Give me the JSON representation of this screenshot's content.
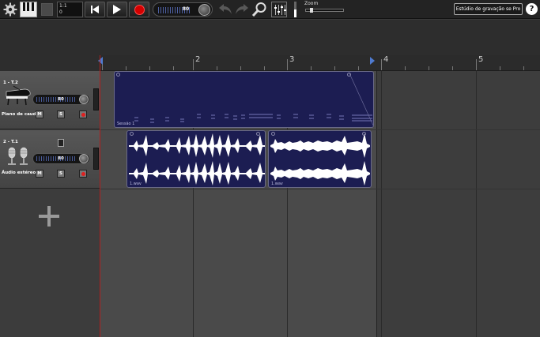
{
  "toolbar": {
    "counter_line1": "1:1",
    "counter_line2": "0",
    "master_volume": "80",
    "zoom_label": "Zoom",
    "pro_button": "Estúdio de gravação se Pro",
    "help": "?"
  },
  "timeline": {
    "bars": [
      "2",
      "3",
      "4",
      "5"
    ]
  },
  "tracks": [
    {
      "title": "1 - T.2",
      "name": "Piano de cauda",
      "instrument_icon": "grand-piano-icon",
      "volume": "80",
      "mute": "M",
      "solo": "S"
    },
    {
      "title": "2 - T.1",
      "name": "Áudio estéreo",
      "instrument_icon": "microphone-icon",
      "volume": "80",
      "mute": "M",
      "solo": "S"
    }
  ],
  "clips": {
    "midi_clip_label": "Sessão 1",
    "audio_clip_1_label": "1.wav",
    "audio_clip_2_label": "1.wav"
  },
  "colors": {
    "clip_fill": "#1c1d52",
    "record_red": "#d40000",
    "loop_marker": "#4f7bd1"
  }
}
